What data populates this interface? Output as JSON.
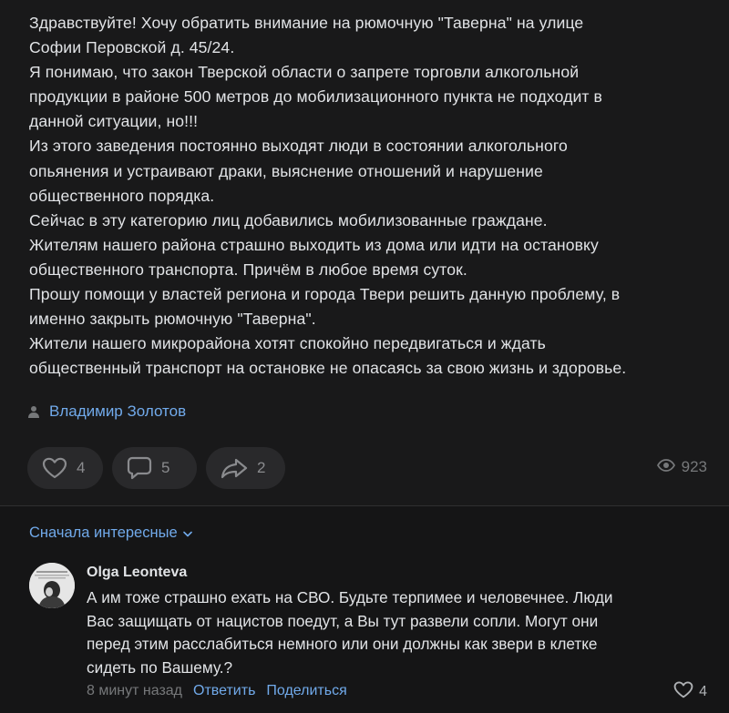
{
  "post": {
    "lines": [
      "Здравствуйте! Хочу обратить внимание на рюмочную \"Таверна\" на улице",
      "Софии Перовской д. 45/24.",
      "Я понимаю, что закон Тверской области о запрете торговли алкогольной",
      "продукции в районе 500 метров до мобилизационного пункта не подходит в",
      "данной ситуации, но!!!",
      "Из этого заведения постоянно выходят люди в состоянии алкогольного",
      "опьянения и устраивают драки, выяснение отношений и нарушение",
      "общественного порядка.",
      "Сейчас в эту категорию лиц добавились мобилизованные граждане.",
      "Жителям нашего района страшно выходить из дома или идти на остановку",
      "общественного транспорта. Причём в любое время суток.",
      "Прошу помощи у властей региона и города Твери решить данную проблему, в",
      "именно закрыть рюмочную \"Таверна\".",
      "Жители нашего микрорайона хотят спокойно передвигаться и ждать",
      "общественный транспорт на остановке не опасаясь за свою жизнь и здоровье."
    ],
    "author": "Владимир Золотов",
    "likes": "4",
    "comments": "5",
    "shares": "2",
    "views": "923",
    "icons": {
      "author": "person-icon",
      "like": "heart-icon",
      "comment": "comment-bubble-icon",
      "share": "share-arrow-icon",
      "views": "eye-icon"
    }
  },
  "comments_section": {
    "sort_label": "Сначала интересные",
    "items": [
      {
        "author": "Olga Leonteva",
        "text_lines": [
          "А им тоже страшно ехать на СВО. Будьте терпимее и человечнее. Люди",
          "Вас защищать от нацистов поедут, а Вы тут развели сопли. Могут они",
          "перед этим расслабиться немного или они должны как звери в клетке",
          "сидеть по Вашему.?"
        ],
        "time": "8 минут назад",
        "reply_label": "Ответить",
        "share_label": "Поделиться",
        "likes": "4"
      }
    ]
  },
  "colors": {
    "background": "#19191a",
    "comments_background": "#151516",
    "text": "#e1e3e6",
    "accent": "#71aaeb",
    "muted": "#76787a",
    "pill": "#29292b"
  }
}
